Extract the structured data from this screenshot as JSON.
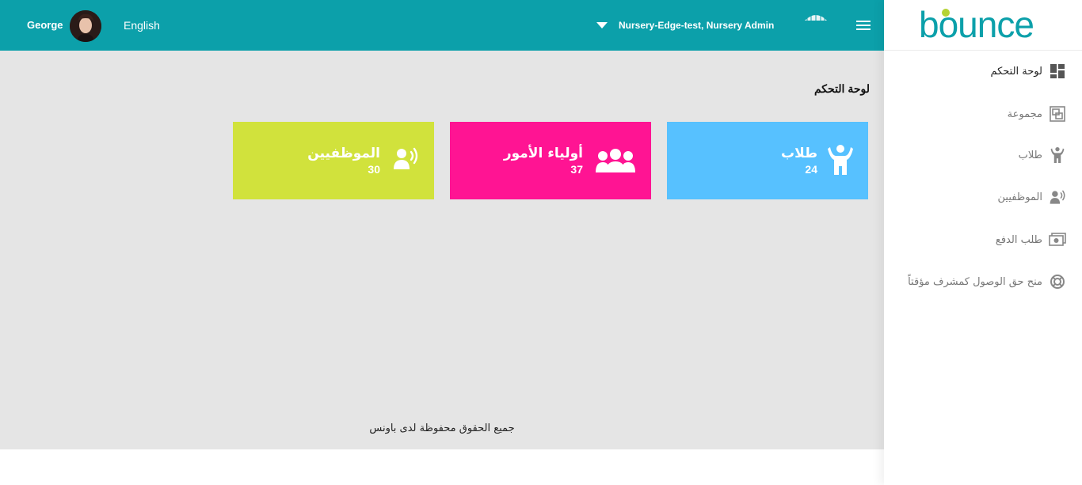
{
  "header": {
    "user_name": "George",
    "language": "English",
    "org_role": "Nursery-Edge-test, Nursery Admin"
  },
  "page": {
    "title": "لوحة التحكم",
    "footer": "جميع الحقوق محفوظة لدى باونس"
  },
  "cards": [
    {
      "title": "طلاب",
      "count": "24",
      "color": "#57c1ff",
      "icon": "child-icon"
    },
    {
      "title": "أولياء الأمور",
      "count": "37",
      "color": "#ff1493",
      "icon": "users-group-icon"
    },
    {
      "title": "الموظفيين",
      "count": "30",
      "color": "#d1e23c",
      "icon": "staff-speaker-icon"
    }
  ],
  "sidebar": {
    "brand": "bounce",
    "items": [
      {
        "label": "لوحة التحكم",
        "icon": "dashboard-icon",
        "active": true
      },
      {
        "label": "مجموعة",
        "icon": "group-icon"
      },
      {
        "label": "طلاب",
        "icon": "child-icon"
      },
      {
        "label": "الموظفيين",
        "icon": "staff-speaker-icon"
      },
      {
        "label": "طلب الدفع",
        "icon": "payment-icon"
      },
      {
        "label": "منح حق الوصول كمشرف مؤقتاً",
        "icon": "lifebuoy-icon"
      }
    ]
  },
  "colors": {
    "header": "#0ca0aa",
    "content_bg": "#e5e5e5",
    "brand": "#0ca0aa",
    "brand_dot": "#b5d334"
  }
}
